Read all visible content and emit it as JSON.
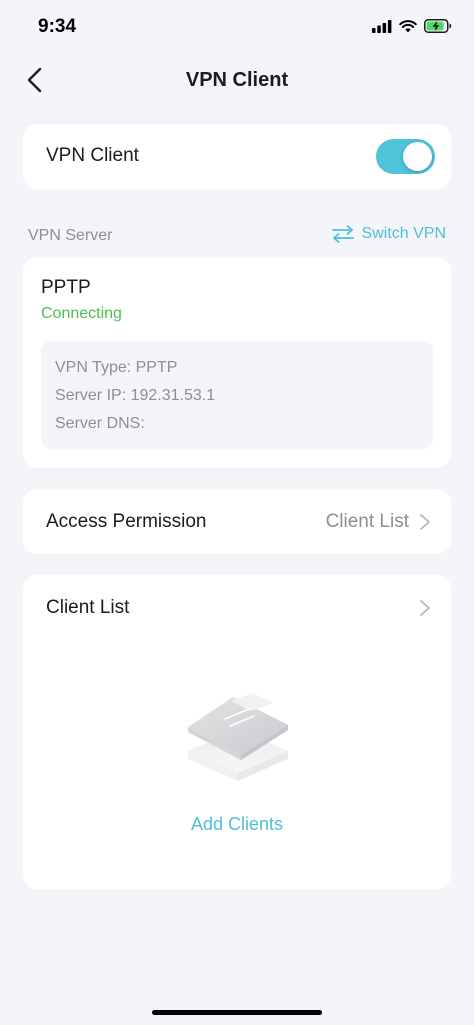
{
  "status_bar": {
    "time": "9:34"
  },
  "nav": {
    "title": "VPN Client"
  },
  "vpn_toggle": {
    "label": "VPN Client",
    "enabled": true
  },
  "server_section": {
    "header": "VPN Server",
    "switch_label": "Switch VPN"
  },
  "server": {
    "protocol": "PPTP",
    "status": "Connecting",
    "details": [
      "VPN Type: PPTP",
      "Server IP: 192.31.53.1",
      "Server DNS:"
    ]
  },
  "access_permission": {
    "label": "Access Permission",
    "value": "Client List"
  },
  "client_list": {
    "label": "Client List",
    "add_label": "Add Clients"
  },
  "colors": {
    "accent": "#4ebfd9",
    "toggle_on": "#4ec3d9",
    "status_connecting": "#4cc14e",
    "background": "#f4f5f9"
  },
  "icons": [
    "signal-icon",
    "wifi-icon",
    "battery-charging-icon",
    "back-chevron-icon",
    "switch-arrows-icon",
    "chevron-right-icon",
    "empty-list-illustration"
  ]
}
